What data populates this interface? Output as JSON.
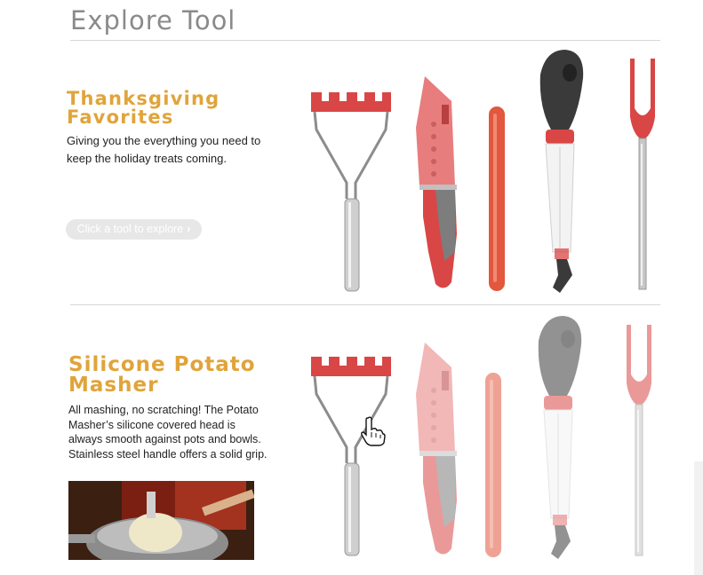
{
  "page": {
    "title": "Explore Tool"
  },
  "intro": {
    "heading_line1": "Thanksgiving",
    "heading_line2": "Favorites",
    "description": "Giving you the everything you need to keep the holiday treats coming.",
    "button_label": "Click a tool to explore",
    "button_chevron": "›"
  },
  "detail": {
    "heading_line1": "Silicone Potato",
    "heading_line2": "Masher",
    "description": "All mashing, no scratching! The Potato Masher’s silicone covered head is always smooth against pots and bowls. Stainless steel handle offers a solid grip."
  },
  "tools": [
    "potato-masher",
    "santoku-knife",
    "silicone-strip",
    "baster",
    "carving-fork"
  ],
  "colors": {
    "accent": "#e0a43a",
    "tool_red": "#d94646",
    "title_gray": "#8a8a8a"
  }
}
